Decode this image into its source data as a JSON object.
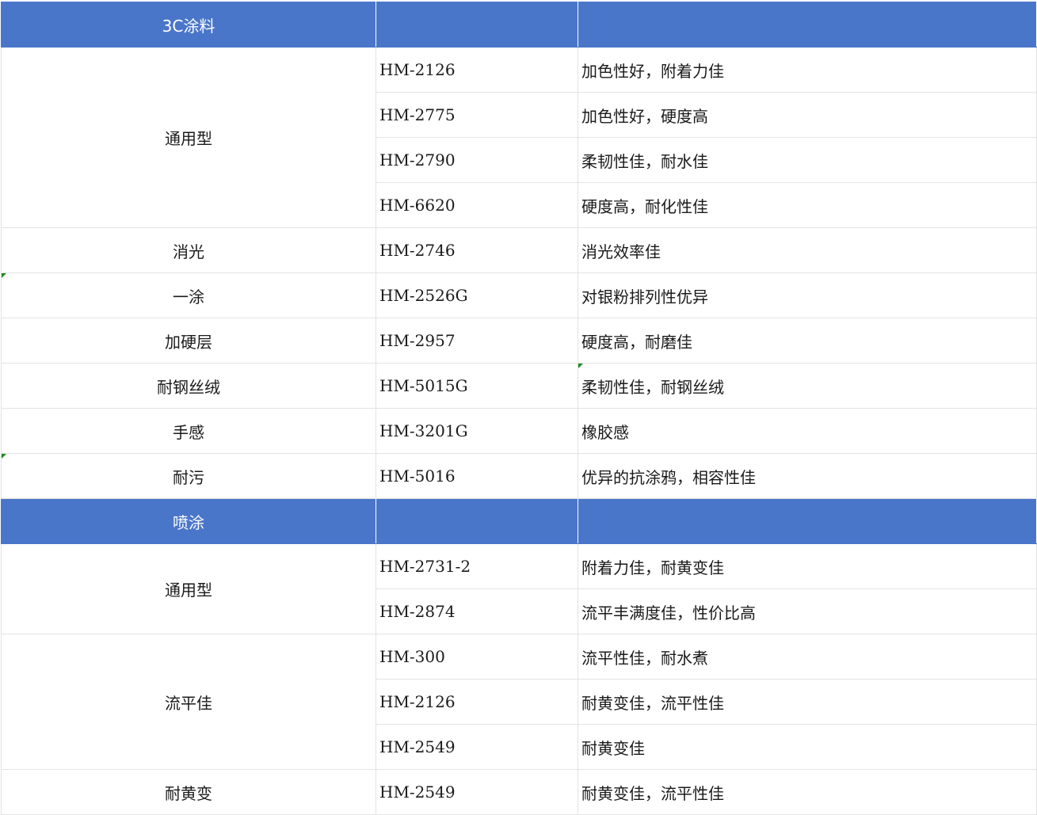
{
  "sections": [
    {
      "title": "3C涂料",
      "groups": [
        {
          "category": "通用型",
          "rows": [
            {
              "model": "HM-2126",
              "desc": "加色性好，附着力佳"
            },
            {
              "model": "HM-2775",
              "desc": "加色性好，硬度高"
            },
            {
              "model": "HM-2790",
              "desc": "柔韧性佳，耐水佳"
            },
            {
              "model": "HM-6620",
              "desc": "硬度高，耐化性佳"
            }
          ]
        },
        {
          "category": "消光",
          "rows": [
            {
              "model": "HM-2746",
              "desc": "消光效率佳"
            }
          ]
        },
        {
          "category": "一涂",
          "mark": true,
          "rows": [
            {
              "model": "HM-2526G",
              "desc": "对银粉排列性优异"
            }
          ]
        },
        {
          "category": "加硬层",
          "rows": [
            {
              "model": "HM-2957",
              "desc": "硬度高，耐磨佳"
            }
          ]
        },
        {
          "category": "耐钢丝绒",
          "rows": [
            {
              "model": "HM-5015G",
              "desc": "柔韧性佳，耐钢丝绒",
              "descMark": true
            }
          ]
        },
        {
          "category": "手感",
          "rows": [
            {
              "model": "HM-3201G",
              "desc": "橡胶感"
            }
          ]
        },
        {
          "category": "耐污",
          "mark": true,
          "rows": [
            {
              "model": "HM-5016",
              "desc": "优异的抗涂鸦，相容性佳"
            }
          ]
        }
      ]
    },
    {
      "title": "喷涂",
      "groups": [
        {
          "category": "通用型",
          "rows": [
            {
              "model": "HM-2731-2",
              "desc": "附着力佳，耐黄变佳"
            },
            {
              "model": "HM-2874",
              "desc": "流平丰满度佳，性价比高"
            }
          ]
        },
        {
          "category": "流平佳",
          "rows": [
            {
              "model": "HM-300",
              "desc": "流平性佳，耐水煮"
            },
            {
              "model": "HM-2126",
              "desc": "耐黄变佳，流平性佳"
            },
            {
              "model": "HM-2549",
              "desc": "耐黄变佳"
            }
          ]
        },
        {
          "category": "耐黄变",
          "rows": [
            {
              "model": "HM-2549",
              "desc": "耐黄变佳，流平性佳"
            }
          ]
        }
      ]
    }
  ]
}
